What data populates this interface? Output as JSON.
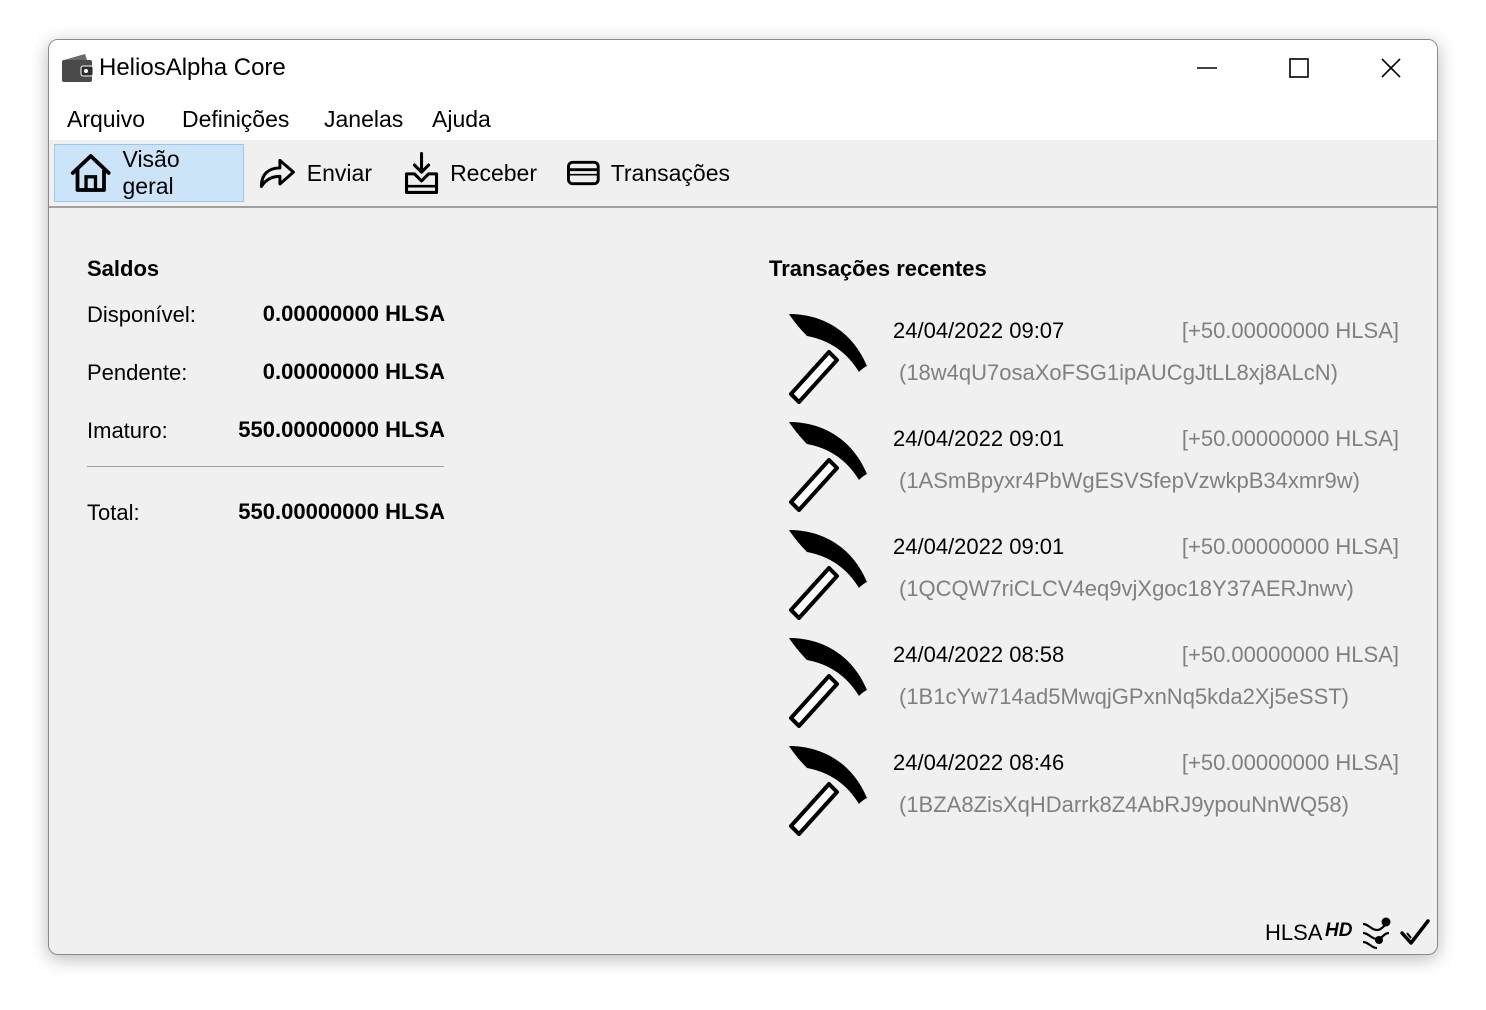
{
  "window": {
    "title": "HeliosAlpha Core"
  },
  "menu": [
    "Arquivo",
    "Definições",
    "Janelas",
    "Ajuda"
  ],
  "toolbar": {
    "overview": "Visão geral",
    "send": "Enviar",
    "receive": "Receber",
    "transactions": "Transações"
  },
  "balances": {
    "title": "Saldos",
    "available_label": "Disponível:",
    "available_value": "0.00000000 HLSA",
    "pending_label": "Pendente:",
    "pending_value": "0.00000000 HLSA",
    "immature_label": "Imaturo:",
    "immature_value": "550.00000000 HLSA",
    "total_label": "Total:",
    "total_value": "550.00000000 HLSA"
  },
  "recent": {
    "title": "Transações recentes",
    "items": [
      {
        "icon": "pickaxe-icon",
        "date": "24/04/2022 09:07",
        "amount": "[+50.00000000 HLSA]",
        "address": "(18w4qU7osaXoFSG1ipAUCgJtLL8xj8ALcN)"
      },
      {
        "icon": "pickaxe-icon",
        "date": "24/04/2022 09:01",
        "amount": "[+50.00000000 HLSA]",
        "address": "(1ASmBpyxr4PbWgESVSfepVzwkpB34xmr9w)"
      },
      {
        "icon": "pickaxe-icon",
        "date": "24/04/2022 09:01",
        "amount": "[+50.00000000 HLSA]",
        "address": "(1QCQW7riCLCV4eq9vjXgoc18Y37AERJnwv)"
      },
      {
        "icon": "pickaxe-icon",
        "date": "24/04/2022 08:58",
        "amount": "[+50.00000000 HLSA]",
        "address": "(1B1cYw714ad5MwqjGPxnNq5kda2Xj5eSST)"
      },
      {
        "icon": "pickaxe-icon",
        "date": "24/04/2022 08:46",
        "amount": "[+50.00000000 HLSA]",
        "address": "(1BZA8ZisXqHDarrk8Z4AbRJ9ypouNnWQ58)"
      }
    ]
  },
  "status": {
    "unit": "HLSA",
    "hd": "HD"
  },
  "colors": {
    "active_tab_bg": "#cce4f7",
    "active_tab_border": "#99c9ef",
    "muted_text": "#808080",
    "window_bg": "#f0f0f0"
  }
}
